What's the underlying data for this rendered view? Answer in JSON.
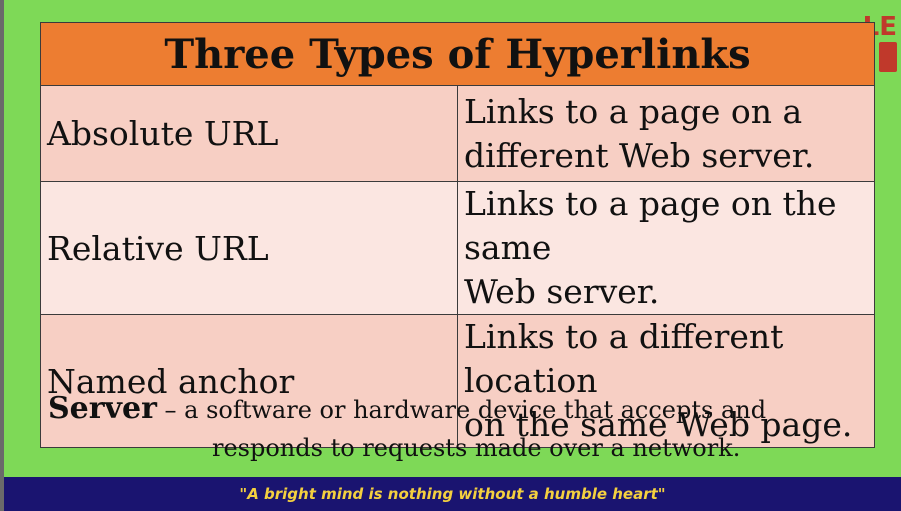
{
  "logo": {
    "text": "LE"
  },
  "table": {
    "title": "Three Types of Hyperlinks",
    "rows": [
      {
        "term": "Absolute URL",
        "description_line1": "Links to a page on a",
        "description_line2": "different Web server."
      },
      {
        "term": "Relative URL",
        "description_line1": "Links to a page on the same",
        "description_line2": "Web server."
      },
      {
        "term": "Named anchor",
        "description_line1": "Links to a different location",
        "description_line2": "on the same Web page."
      }
    ]
  },
  "definition": {
    "word": "Server",
    "text_line1": " – a software or hardware device that accepts and",
    "text_line2": "responds to requests made over a network."
  },
  "footer": {
    "quote": "\"A bright mind is nothing without a humble heart\""
  },
  "colors": {
    "background": "#7ed957",
    "title_fill": "#ed7d31",
    "row_fill_dark": "#f7cfc4",
    "row_fill_light": "#fbe6e1",
    "footer_fill": "#1a1470",
    "footer_text": "#f4d03f",
    "logo": "#c0392b"
  }
}
